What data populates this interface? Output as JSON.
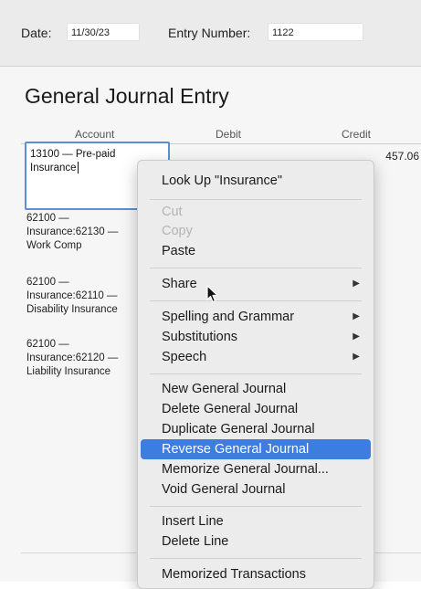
{
  "header": {
    "date_label": "Date:",
    "date_value": "11/30/23",
    "entry_label": "Entry Number:",
    "entry_value": "1122"
  },
  "page_title": "General Journal Entry",
  "columns": {
    "account": "Account",
    "debit": "Debit",
    "credit": "Credit"
  },
  "entries": [
    {
      "account_line1": "13100 — Pre-paid",
      "account_line2": "Insurance",
      "credit": "457.06"
    },
    {
      "account_lines": [
        "62100 —",
        "Insurance:62130 —",
        "Work Comp"
      ]
    },
    {
      "account_lines": [
        "62100 —",
        "Insurance:62110 —",
        "Disability Insurance"
      ]
    },
    {
      "account_lines": [
        "62100 —",
        "Insurance:62120 —",
        "Liability Insurance"
      ]
    }
  ],
  "context_menu": {
    "items": [
      {
        "label": "Look Up \"Insurance\""
      },
      {
        "label": "Cut",
        "state": "disabled"
      },
      {
        "label": "Copy",
        "state": "disabled"
      },
      {
        "label": "Paste"
      },
      {
        "label": "Share",
        "submenu": true
      },
      {
        "label": "Spelling and Grammar",
        "submenu": true
      },
      {
        "label": "Substitutions",
        "submenu": true
      },
      {
        "label": "Speech",
        "submenu": true
      },
      {
        "label": "New General Journal"
      },
      {
        "label": "Delete General Journal"
      },
      {
        "label": "Duplicate General Journal"
      },
      {
        "label": "Reverse General Journal",
        "state": "highlighted"
      },
      {
        "label": "Memorize General Journal..."
      },
      {
        "label": "Void General Journal"
      },
      {
        "label": "Insert Line"
      },
      {
        "label": "Delete Line"
      },
      {
        "label": "Memorized Transactions"
      }
    ],
    "submenu_arrow": "▶"
  },
  "colors": {
    "highlight": "#3d7de0",
    "field_border": "#5b8fd9",
    "disabled_text": "#b4b4b4"
  },
  "icons": {
    "pointer": "mouse-pointer-icon",
    "submenu": "submenu-arrow-icon"
  }
}
